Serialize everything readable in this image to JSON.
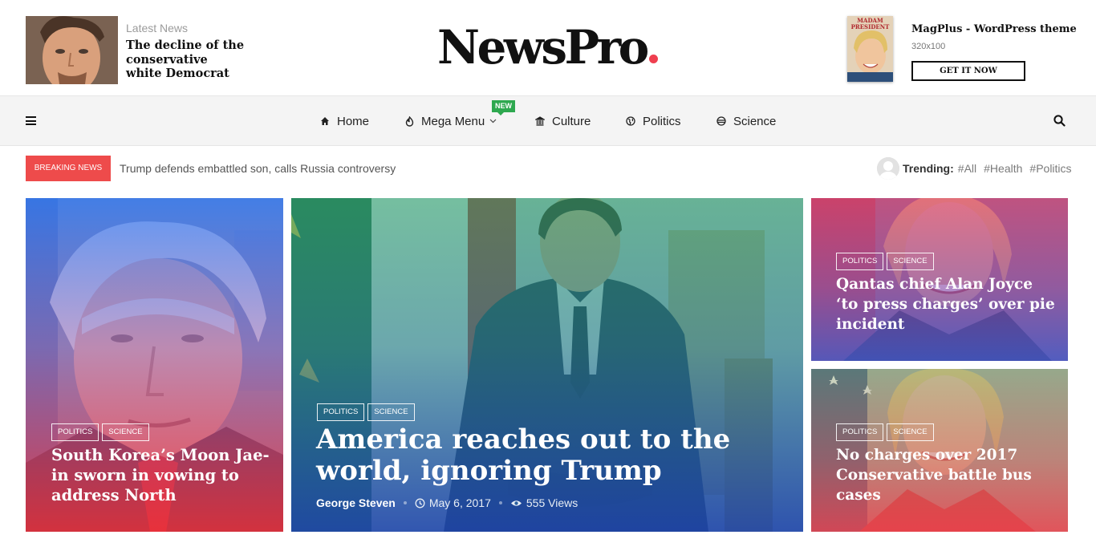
{
  "header": {
    "latest_kicker": "Latest News",
    "latest_title": "The decline of the conservative white Democrat",
    "logo_text": "NewsPro",
    "logo_dot_color": "#ef3f4f",
    "promo_title": "MagPlus - WordPress theme",
    "promo_size": "320x100",
    "promo_button": "GET IT NOW",
    "promo_cover_title": "MADAM PRESIDENT"
  },
  "nav": {
    "items": [
      {
        "label": "Home",
        "icon": "home-icon"
      },
      {
        "label": "Mega Menu",
        "icon": "fire-icon",
        "badge": "NEW"
      },
      {
        "label": "Culture",
        "icon": "building-icon"
      },
      {
        "label": "Politics",
        "icon": "globe-icon"
      },
      {
        "label": "Science",
        "icon": "planet-icon"
      }
    ],
    "badge_color": "#2ea84f"
  },
  "breaking": {
    "label": "BREAKING NEWS",
    "text": "Trump defends embattled son, calls Russia controversy",
    "color": "#ee4b4b"
  },
  "trending": {
    "label": "Trending:",
    "tags": [
      "#All",
      "#Health",
      "#Politics"
    ]
  },
  "cards": [
    {
      "title": "South Korea’s Moon Jae-in sworn in vowing to address North",
      "categories": [
        "POLITICS",
        "SCIENCE"
      ]
    },
    {
      "title": "America reaches out to the world, ignoring Trump",
      "categories": [
        "POLITICS",
        "SCIENCE"
      ],
      "author": "George Steven",
      "date": "May 6, 2017",
      "views": "555 Views"
    },
    {
      "title": "Qantas chief Alan Joyce ‘to press charges’ over pie incident",
      "categories": [
        "POLITICS",
        "SCIENCE"
      ]
    },
    {
      "title": "No charges over 2017 Conservative battle bus cases",
      "categories": [
        "POLITICS",
        "SCIENCE"
      ]
    }
  ]
}
